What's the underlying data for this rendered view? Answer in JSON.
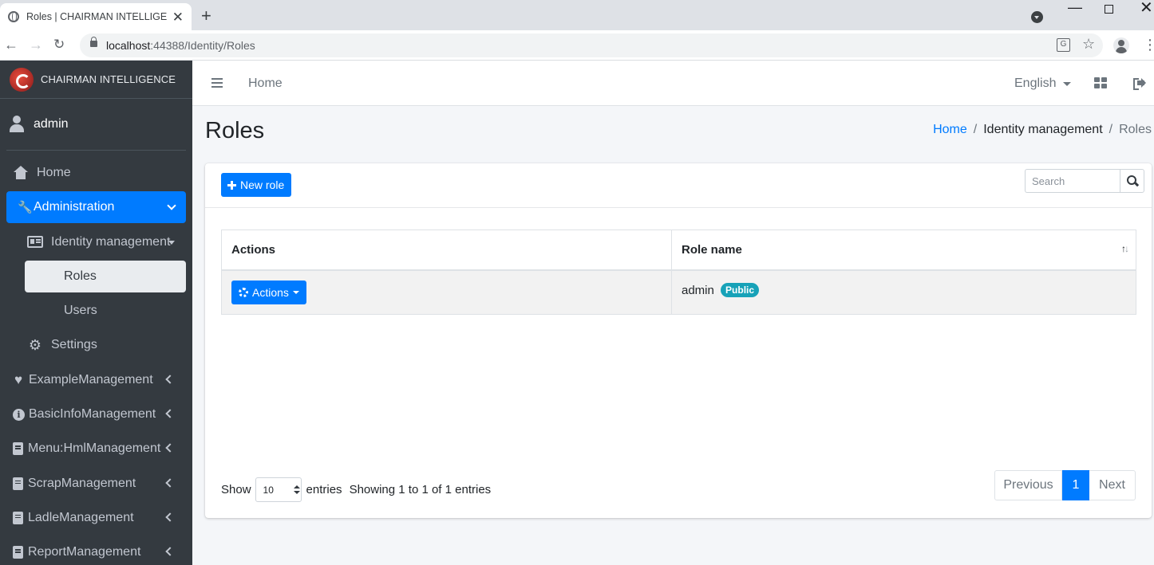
{
  "browser": {
    "tab_title": "Roles | CHAIRMAN INTELLIGENCE",
    "url_host": "localhost",
    "url_port_path": ":44388/Identity/Roles"
  },
  "sidebar": {
    "brand": "CHAIRMAN INTELLIGENCE",
    "user": "admin",
    "items": [
      {
        "label": "Home",
        "icon": "home-icon"
      },
      {
        "label": "Administration",
        "icon": "wrench-icon",
        "active": true
      },
      {
        "label": "Identity management",
        "icon": "id-card-icon"
      },
      {
        "label": "Roles",
        "selected": true
      },
      {
        "label": "Users"
      },
      {
        "label": "Settings",
        "icon": "gear-icon"
      },
      {
        "label": "ExampleManagement",
        "icon": "heart-icon"
      },
      {
        "label": "BasicInfoManagement",
        "icon": "info-icon"
      },
      {
        "label": "Menu:HmlManagement",
        "icon": "book-icon"
      },
      {
        "label": "ScrapManagement",
        "icon": "book-icon"
      },
      {
        "label": "LadleManagement",
        "icon": "book-icon"
      },
      {
        "label": "ReportManagement",
        "icon": "book-icon"
      }
    ]
  },
  "topnav": {
    "home": "Home",
    "language": "English"
  },
  "page": {
    "title": "Roles",
    "breadcrumb": [
      "Home",
      "Identity management",
      "Roles"
    ]
  },
  "card": {
    "new_role_label": "New role",
    "search_placeholder": "Search"
  },
  "table": {
    "headers": [
      "Actions",
      "Role name"
    ],
    "rows": [
      {
        "actions_label": "Actions",
        "role_name": "admin",
        "badge": "Public"
      }
    ]
  },
  "footer": {
    "show_label": "Show",
    "page_length": "10",
    "entries_label": "entries",
    "info": "Showing 1 to 1 of 1 entries",
    "previous": "Previous",
    "current_page": "1",
    "next": "Next"
  },
  "colors": {
    "primary": "#007bff",
    "sidebar_bg": "#343a40",
    "badge": "#17a2b8"
  }
}
